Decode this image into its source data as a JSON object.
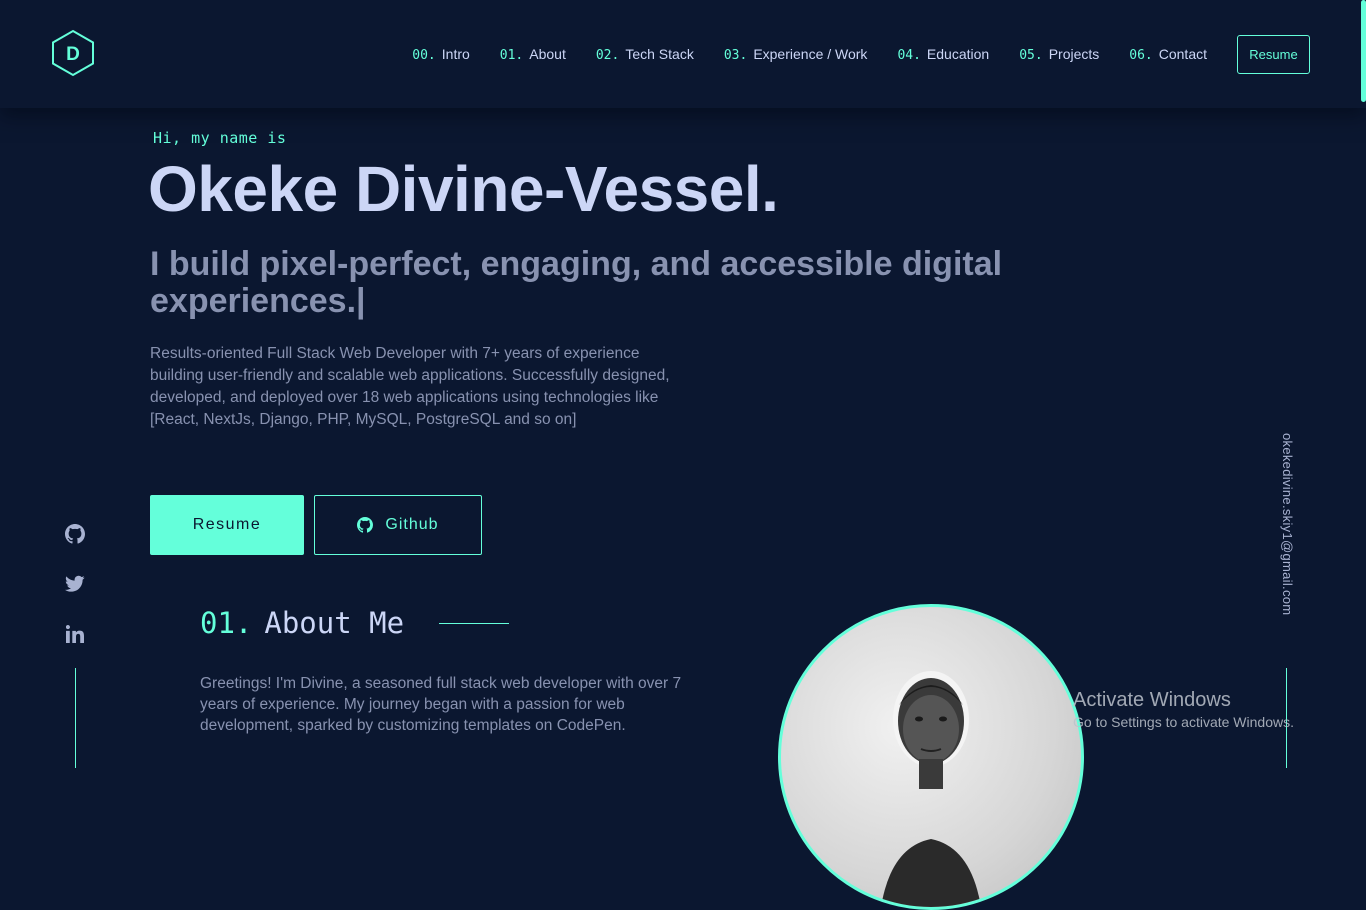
{
  "nav": {
    "logo_letter": "D",
    "items": [
      {
        "num": "00.",
        "label": "Intro"
      },
      {
        "num": "01.",
        "label": "About"
      },
      {
        "num": "02.",
        "label": "Tech Stack"
      },
      {
        "num": "03.",
        "label": "Experience / Work"
      },
      {
        "num": "04.",
        "label": "Education"
      },
      {
        "num": "05.",
        "label": "Projects"
      },
      {
        "num": "06.",
        "label": "Contact"
      }
    ],
    "resume_label": "Resume"
  },
  "hero": {
    "greeting": "Hi, my name is",
    "name": "Okeke Divine-Vessel.",
    "tagline": "I build pixel-perfect, engaging, and accessible digital experiences.|",
    "description": "Results-oriented Full Stack Web Developer with 7+ years of experience building user-friendly and scalable web applications. Successfully designed, developed, and deployed over 18 web applications using technologies like [React, NextJs, Django, PHP, MySQL, PostgreSQL and so on]",
    "resume_button": "Resume",
    "github_button": "Github"
  },
  "social": {
    "icons": [
      "github-icon",
      "twitter-icon",
      "linkedin-icon"
    ],
    "email": "okekedivine.skiy1@gmail.com"
  },
  "about": {
    "num": "01.",
    "title": "About Me",
    "text": "Greetings! I'm Divine, a seasoned full stack web developer with over 7 years of experience. My journey began with a passion for web development, sparked by customizing templates on CodePen."
  },
  "watermark": {
    "title": "Activate Windows",
    "subtitle": "Go to Settings to activate Windows."
  },
  "colors": {
    "background": "#0b1730",
    "accent": "#64ffda",
    "heading": "#ccd6f6",
    "muted": "#8892b0"
  }
}
